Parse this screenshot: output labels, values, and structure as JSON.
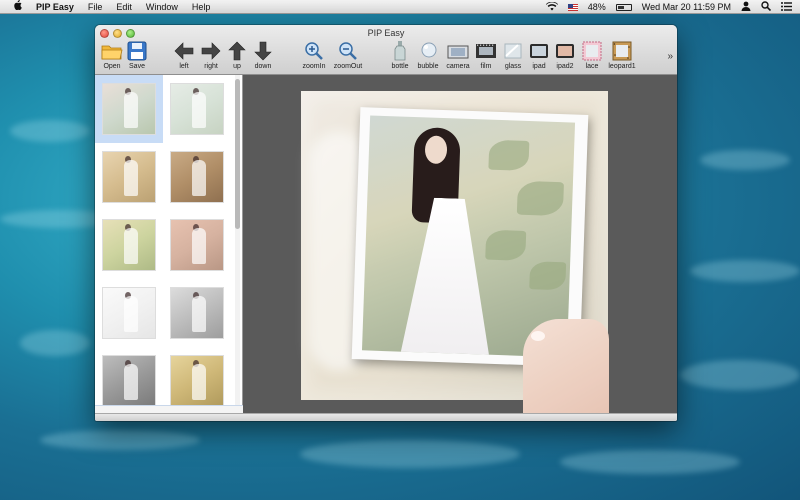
{
  "menubar": {
    "apple": "",
    "app_name": "PIP Easy",
    "menus": [
      "File",
      "Edit",
      "Window",
      "Help"
    ],
    "battery": "48%",
    "datetime": "Wed Mar 20  11:59 PM"
  },
  "window": {
    "title": "PIP Easy",
    "toolbar": {
      "open": "Open",
      "save": "Save",
      "left": "left",
      "right": "right",
      "up": "up",
      "down": "down",
      "zoomin": "zoomIn",
      "zoomout": "zoomOut",
      "bottle": "bottle",
      "bubble": "bubble",
      "camera": "camera",
      "film": "film",
      "glass": "glass",
      "ipad": "ipad",
      "ipad2": "ipad2",
      "lace": "lace",
      "leopard1": "leopard1",
      "more": "»"
    }
  },
  "thumbnails": {
    "selected_index": 0,
    "items": [
      "normal",
      "faded",
      "warm",
      "sepia",
      "green",
      "rose",
      "light",
      "grey",
      "bw",
      "gold"
    ]
  },
  "colors": {
    "desktop": "#1f8fae",
    "canvas": "#5a5a5a",
    "selection": "#c8dcf6"
  }
}
